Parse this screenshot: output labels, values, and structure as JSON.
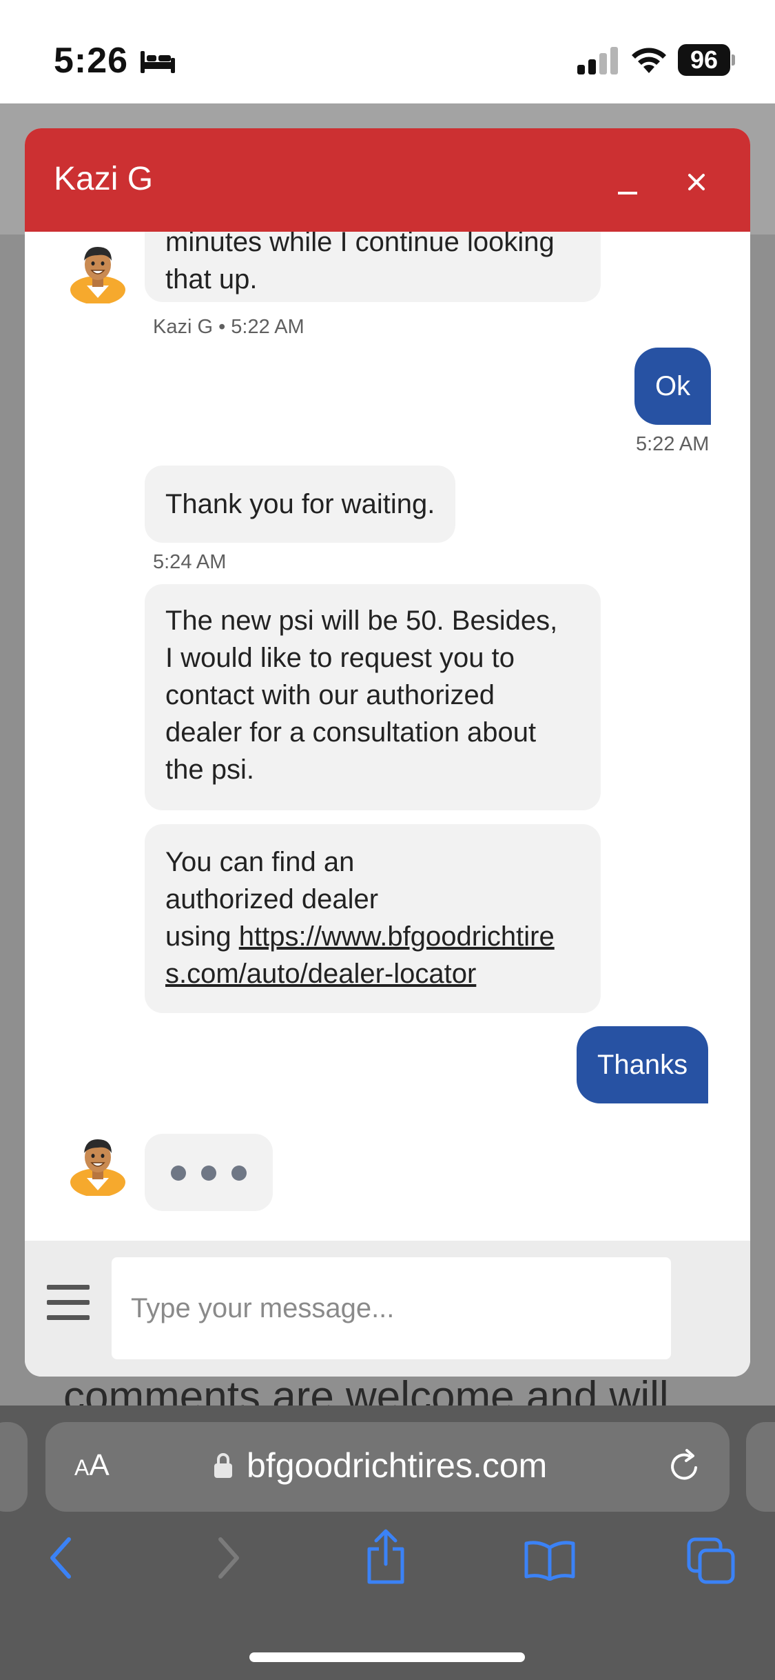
{
  "status": {
    "time": "5:26",
    "battery": "96",
    "focus_icon": "bed-icon",
    "signal_icon": "cellular-signal-icon",
    "wifi_icon": "wifi-icon"
  },
  "background_page": {
    "text": "comments are welcome and will"
  },
  "chat": {
    "agent_name": "Kazi G",
    "header_color": "#cc3032",
    "user_bubble_color": "#2752a3",
    "minimize_icon": "minimize-icon",
    "close_icon": "close-icon",
    "messages": [
      {
        "text": "minutes while I continue looking",
        "sender": "agent"
      },
      {
        "text": "that up.",
        "sender": "agent",
        "meta": "Kazi G • 5:22 AM"
      },
      {
        "text": "Ok",
        "sender": "user",
        "meta": "5:22 AM"
      },
      {
        "text": "Thank you for waiting.",
        "sender": "agent",
        "meta": "5:24 AM"
      },
      {
        "lines": [
          "The new psi will be 50. Besides,",
          "I would like to request you to",
          "contact with our authorized",
          "dealer for a consultation about",
          "the psi."
        ],
        "sender": "agent"
      },
      {
        "lines": [
          "You can find an",
          "authorized dealer",
          "using"
        ],
        "link_lines": [
          "https://www.bfgoodrichtire",
          "s.com/auto/dealer-locator"
        ],
        "sender": "agent"
      },
      {
        "text": "Thanks",
        "sender": "user"
      }
    ],
    "typing_indicator": "typing-indicator",
    "input_placeholder": "Type your message..."
  },
  "browser": {
    "text_size_label_small": "A",
    "text_size_label_large": "A",
    "url": "bfgoodrichtires.com",
    "toolbar_icons": [
      "back-icon",
      "forward-icon",
      "share-icon",
      "bookmarks-icon",
      "tabs-icon"
    ],
    "accent": "#3b82f6"
  }
}
